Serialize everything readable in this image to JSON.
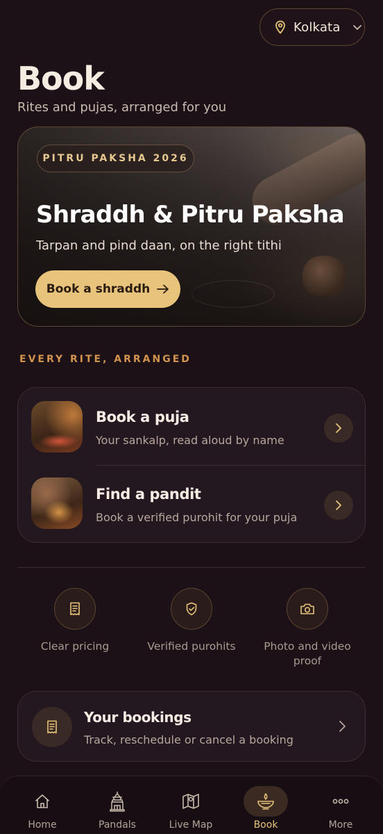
{
  "location": {
    "city": "Kolkata"
  },
  "page": {
    "title": "Book",
    "subtitle": "Rites and pujas, arranged for you"
  },
  "hero": {
    "badge": "PITRU PAKSHA 2026",
    "title": "Shraddh & Pitru Paksha",
    "subtitle": "Tarpan and pind daan, on the right tithi",
    "cta": "Book a shraddh"
  },
  "section_label": "EVERY RITE, ARRANGED",
  "rites": [
    {
      "title": "Book a puja",
      "description": "Your sankalp, read aloud by name"
    },
    {
      "title": "Find a pandit",
      "description": "Book a verified purohit for your puja"
    }
  ],
  "features": [
    {
      "icon": "receipt-icon",
      "label": "Clear pricing"
    },
    {
      "icon": "shield-check-icon",
      "label": "Verified purohits"
    },
    {
      "icon": "camera-icon",
      "label": "Photo and video proof"
    }
  ],
  "bookings": {
    "title": "Your bookings",
    "description": "Track, reschedule or cancel a booking"
  },
  "tabs": [
    {
      "icon": "home-icon",
      "label": "Home"
    },
    {
      "icon": "pandal-icon",
      "label": "Pandals"
    },
    {
      "icon": "map-icon",
      "label": "Live Map"
    },
    {
      "icon": "diya-icon",
      "label": "Book"
    },
    {
      "icon": "more-icon",
      "label": "More"
    }
  ],
  "colors": {
    "background": "#1c1117",
    "accent": "#e8c37c",
    "section_label": "#d0944f",
    "card": "#241820"
  }
}
